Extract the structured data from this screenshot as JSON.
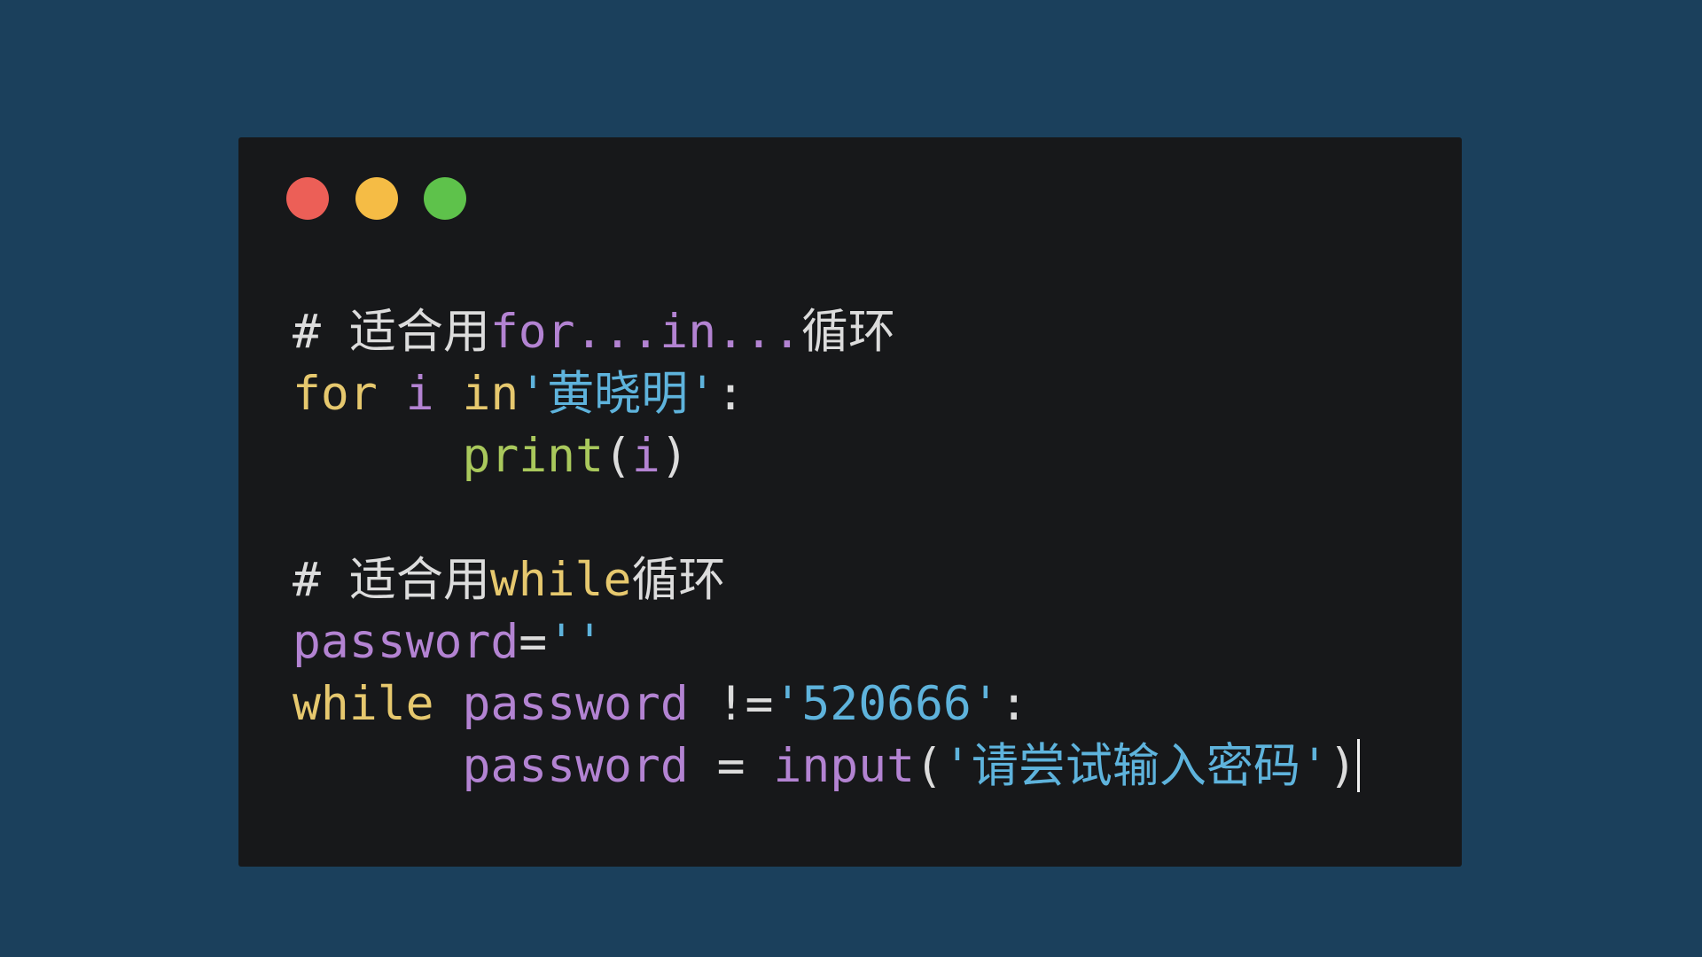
{
  "window": {
    "traffic_lights": [
      {
        "name": "close",
        "color": "#ec5f57"
      },
      {
        "name": "minimize",
        "color": "#f5bc45"
      },
      {
        "name": "maximize",
        "color": "#5ec24b"
      }
    ]
  },
  "code": {
    "lines": [
      [
        {
          "t": "# 适合用",
          "c": "comment"
        },
        {
          "t": "for...in...",
          "c": "var"
        },
        {
          "t": "循环",
          "c": "comment"
        }
      ],
      [
        {
          "t": "for ",
          "c": "keyword"
        },
        {
          "t": "i ",
          "c": "var"
        },
        {
          "t": "in",
          "c": "keyword"
        },
        {
          "t": "'黄晓明'",
          "c": "string"
        },
        {
          "t": ":",
          "c": "plain"
        }
      ],
      [
        {
          "t": "      ",
          "c": "plain"
        },
        {
          "t": "print",
          "c": "func"
        },
        {
          "t": "(",
          "c": "plain"
        },
        {
          "t": "i",
          "c": "var"
        },
        {
          "t": ")",
          "c": "plain"
        }
      ],
      [],
      [
        {
          "t": "# 适合用",
          "c": "comment"
        },
        {
          "t": "while",
          "c": "keyword"
        },
        {
          "t": "循环",
          "c": "comment"
        }
      ],
      [
        {
          "t": "password",
          "c": "var"
        },
        {
          "t": "=",
          "c": "plain"
        },
        {
          "t": "''",
          "c": "string"
        }
      ],
      [
        {
          "t": "while ",
          "c": "keyword"
        },
        {
          "t": "password ",
          "c": "var"
        },
        {
          "t": "!=",
          "c": "plain"
        },
        {
          "t": "'520666'",
          "c": "string"
        },
        {
          "t": ":",
          "c": "plain"
        }
      ],
      [
        {
          "t": "      ",
          "c": "plain"
        },
        {
          "t": "password ",
          "c": "var"
        },
        {
          "t": "= ",
          "c": "plain"
        },
        {
          "t": "input",
          "c": "var"
        },
        {
          "t": "(",
          "c": "plain"
        },
        {
          "t": "'请尝试输入密码'",
          "c": "string"
        },
        {
          "t": ")",
          "c": "plain"
        }
      ]
    ]
  }
}
